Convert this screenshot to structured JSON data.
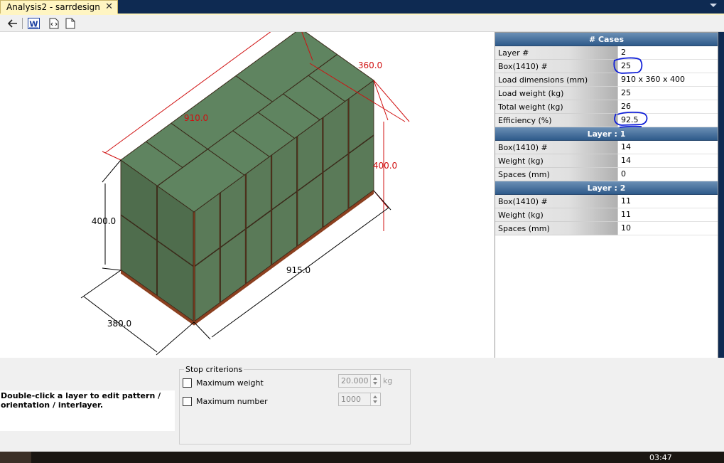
{
  "document_tab": {
    "title": "Analysis2 - sarrdesign",
    "close_glyph": "✕"
  },
  "toolbar": {
    "back_icon": "back-arrow-icon",
    "word_icon": "word-export-icon",
    "word_glyph": "W",
    "export_icon": "export-code-icon",
    "page_icon": "document-icon"
  },
  "view3d": {
    "dim_length": "910.0",
    "dim_width": "360.0",
    "dim_height_right": "400.0",
    "dim_height_left": "400.0",
    "dim_outer_length": "915.0",
    "dim_outer_width": "380.0",
    "box_color": "#5a7a58",
    "box_top_color": "#5f8460",
    "pallet_color": "#8b4020",
    "dim_color_red": "#d01010"
  },
  "properties": {
    "cases_header": "# Cases",
    "cases_rows": [
      {
        "label": "Layer #",
        "value": "2"
      },
      {
        "label": "Box(1410) #",
        "value": "25"
      },
      {
        "label": "Load dimensions (mm)",
        "value": "910 x 360 x 400"
      },
      {
        "label": "Load weight (kg)",
        "value": "25"
      },
      {
        "label": "Total weight (kg)",
        "value": "26"
      },
      {
        "label": "Efficiency (%)",
        "value": "92.5"
      }
    ],
    "layer1_header": "Layer : 1",
    "layer1_rows": [
      {
        "label": "Box(1410) #",
        "value": "14"
      },
      {
        "label": "Weight (kg)",
        "value": "14"
      },
      {
        "label": "Spaces (mm)",
        "value": "0"
      }
    ],
    "layer2_header": "Layer : 2",
    "layer2_rows": [
      {
        "label": "Box(1410) #",
        "value": "11"
      },
      {
        "label": "Weight (kg)",
        "value": "11"
      },
      {
        "label": "Spaces (mm)",
        "value": "10"
      }
    ]
  },
  "instruction": "Double-click a layer to edit pattern / orientation / interlayer.",
  "stop_criterions": {
    "title": "Stop criterions",
    "max_weight_label": "Maximum weight",
    "max_weight_value": "20.000",
    "max_weight_unit": "kg",
    "max_number_label": "Maximum number",
    "max_number_value": "1000"
  },
  "taskbar": {
    "clock": "03:47"
  }
}
